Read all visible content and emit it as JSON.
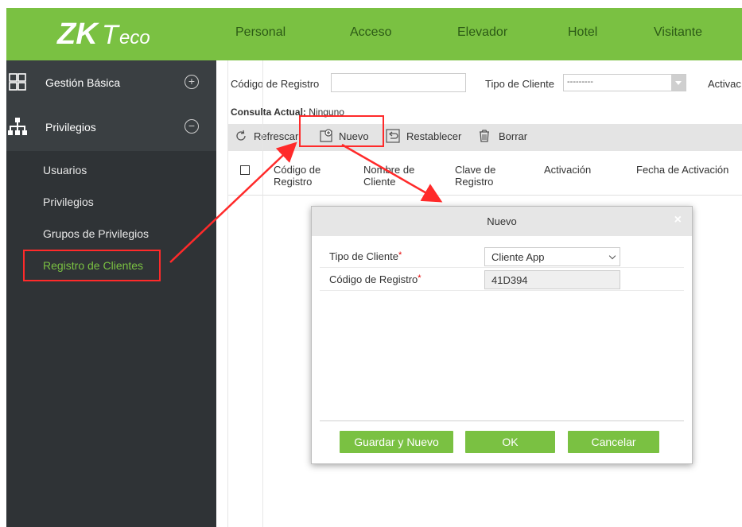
{
  "brand": {
    "logo_text": "ZKTeco",
    "accent": "#7ac142",
    "sidebar_bg": "#3a3f42"
  },
  "topnav": {
    "items": [
      {
        "label": "Personal"
      },
      {
        "label": "Acceso"
      },
      {
        "label": "Elevador"
      },
      {
        "label": "Hotel"
      },
      {
        "label": "Visitante"
      }
    ]
  },
  "sidebar": {
    "sections": [
      {
        "label": "Gestión Básica",
        "icon": "grid-icon",
        "toggle": "+"
      },
      {
        "label": "Privilegios",
        "icon": "org-chart-icon",
        "toggle": "−"
      }
    ],
    "items": [
      {
        "label": "Usuarios"
      },
      {
        "label": "Privilegios"
      },
      {
        "label": "Grupos de Privilegios"
      },
      {
        "label": "Registro de Clientes",
        "active": true
      }
    ]
  },
  "filters": {
    "codigo_label": "Código de Registro",
    "codigo_value": "",
    "tipo_label": "Tipo de Cliente",
    "tipo_value": "---------",
    "activacion_label": "Activac"
  },
  "consulta": {
    "label": "Consulta Actual:",
    "value": "Ninguno"
  },
  "toolbar": {
    "refrescar": "Refrescar",
    "nuevo": "Nuevo",
    "restablecer": "Restablecer",
    "borrar": "Borrar"
  },
  "table": {
    "headers": [
      "Código de\nRegistro",
      "Nombre de\nCliente",
      "Clave de\nRegistro",
      "Activación",
      "Fecha de Activación"
    ]
  },
  "modal": {
    "title": "Nuevo",
    "close": "×",
    "fields": [
      {
        "label": "Tipo de Cliente",
        "required_mark": "*",
        "value": "Cliente App"
      },
      {
        "label": "Código de Registro",
        "required_mark": "*",
        "value": "41D394"
      }
    ],
    "buttons": {
      "save_new": "Guardar y Nuevo",
      "ok": "OK",
      "cancel": "Cancelar"
    }
  },
  "annotation_color": "#ff2a2a"
}
